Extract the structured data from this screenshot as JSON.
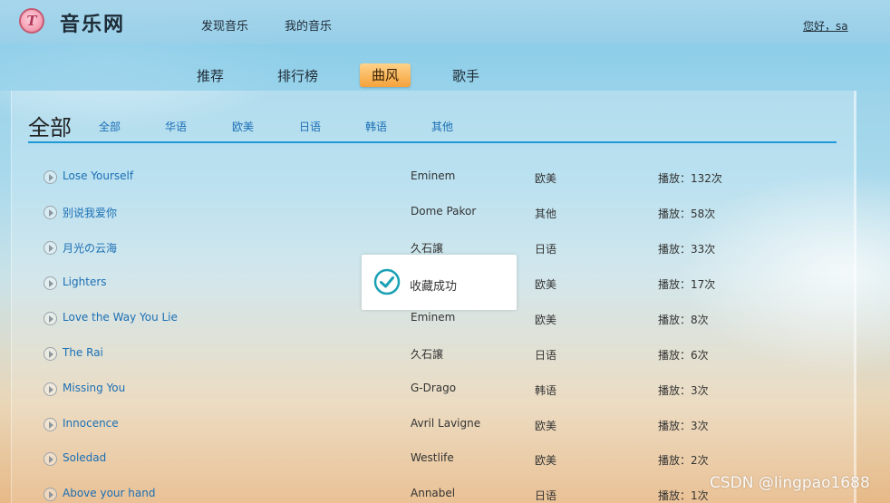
{
  "header": {
    "logo_letter": "T",
    "app_title": "音乐网",
    "nav": [
      "发现音乐",
      "我的音乐"
    ],
    "greeting": "您好，sa"
  },
  "subnav": {
    "items": [
      "推荐",
      "排行榜",
      "曲风",
      "歌手"
    ],
    "active": "曲风"
  },
  "category": {
    "title": "全部",
    "tabs": [
      "全部",
      "华语",
      "欧美",
      "日语",
      "韩语",
      "其他"
    ]
  },
  "songs": [
    {
      "name": "Lose Yourself",
      "artist": "Eminem",
      "region": "欧美",
      "plays": "播放：132次"
    },
    {
      "name": "别说我爱你",
      "artist": "Dome Pakor",
      "region": "其他",
      "plays": "播放：58次"
    },
    {
      "name": "月光の云海",
      "artist": "久石譲",
      "region": "日语",
      "plays": "播放：33次"
    },
    {
      "name": "Lighters",
      "artist": "",
      "region": "欧美",
      "plays": "播放：17次"
    },
    {
      "name": "Love the Way You Lie",
      "artist": "Eminem",
      "region": "欧美",
      "plays": "播放：8次"
    },
    {
      "name": "The Rai",
      "artist": "久石譲",
      "region": "日语",
      "plays": "播放：6次"
    },
    {
      "name": "Missing You",
      "artist": "G-Drago",
      "region": "韩语",
      "plays": "播放：3次"
    },
    {
      "name": "Innocence",
      "artist": "Avril Lavigne",
      "region": "欧美",
      "plays": "播放：3次"
    },
    {
      "name": "Soledad",
      "artist": "Westlife",
      "region": "欧美",
      "plays": "播放：2次"
    },
    {
      "name": "Above your hand",
      "artist": "Annabel",
      "region": "日语",
      "plays": "播放：1次"
    }
  ],
  "toast": {
    "icon": "check-circle-icon",
    "message": "收藏成功"
  },
  "watermark": "CSDN @lingpao1688",
  "colors": {
    "link": "#1b6fb5",
    "accent_line": "#1f9ad6",
    "active_tab": "#f5a23b",
    "toast_check": "#1aa1b5"
  }
}
